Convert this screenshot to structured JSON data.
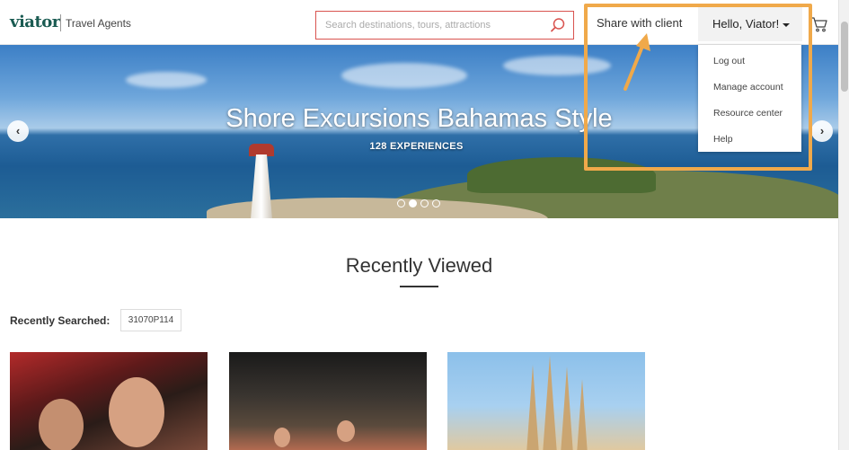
{
  "header": {
    "logo": "viator",
    "logo_sub": "Travel Agents",
    "search_placeholder": "Search destinations, tours, attractions",
    "share_label": "Share with client",
    "hello_label": "Hello, Viator!"
  },
  "dropdown": {
    "items": [
      "Log out",
      "Manage account",
      "Resource center",
      "Help"
    ]
  },
  "hero": {
    "title": "Shore Excursions Bahamas Style",
    "subtitle": "128 EXPERIENCES",
    "prev_label": "‹",
    "next_label": "›",
    "slide_count": 4,
    "active_slide": 2
  },
  "main": {
    "section_title": "Recently Viewed",
    "recent_label": "Recently Searched:",
    "recent_chip": "31070P114"
  },
  "colors": {
    "brand": "#1a5b52",
    "search_border": "#d9534f",
    "annotation": "#f0a94a"
  },
  "icons": {
    "search": "search-icon",
    "cart": "cart-icon",
    "caret": "chevron-down-icon"
  }
}
